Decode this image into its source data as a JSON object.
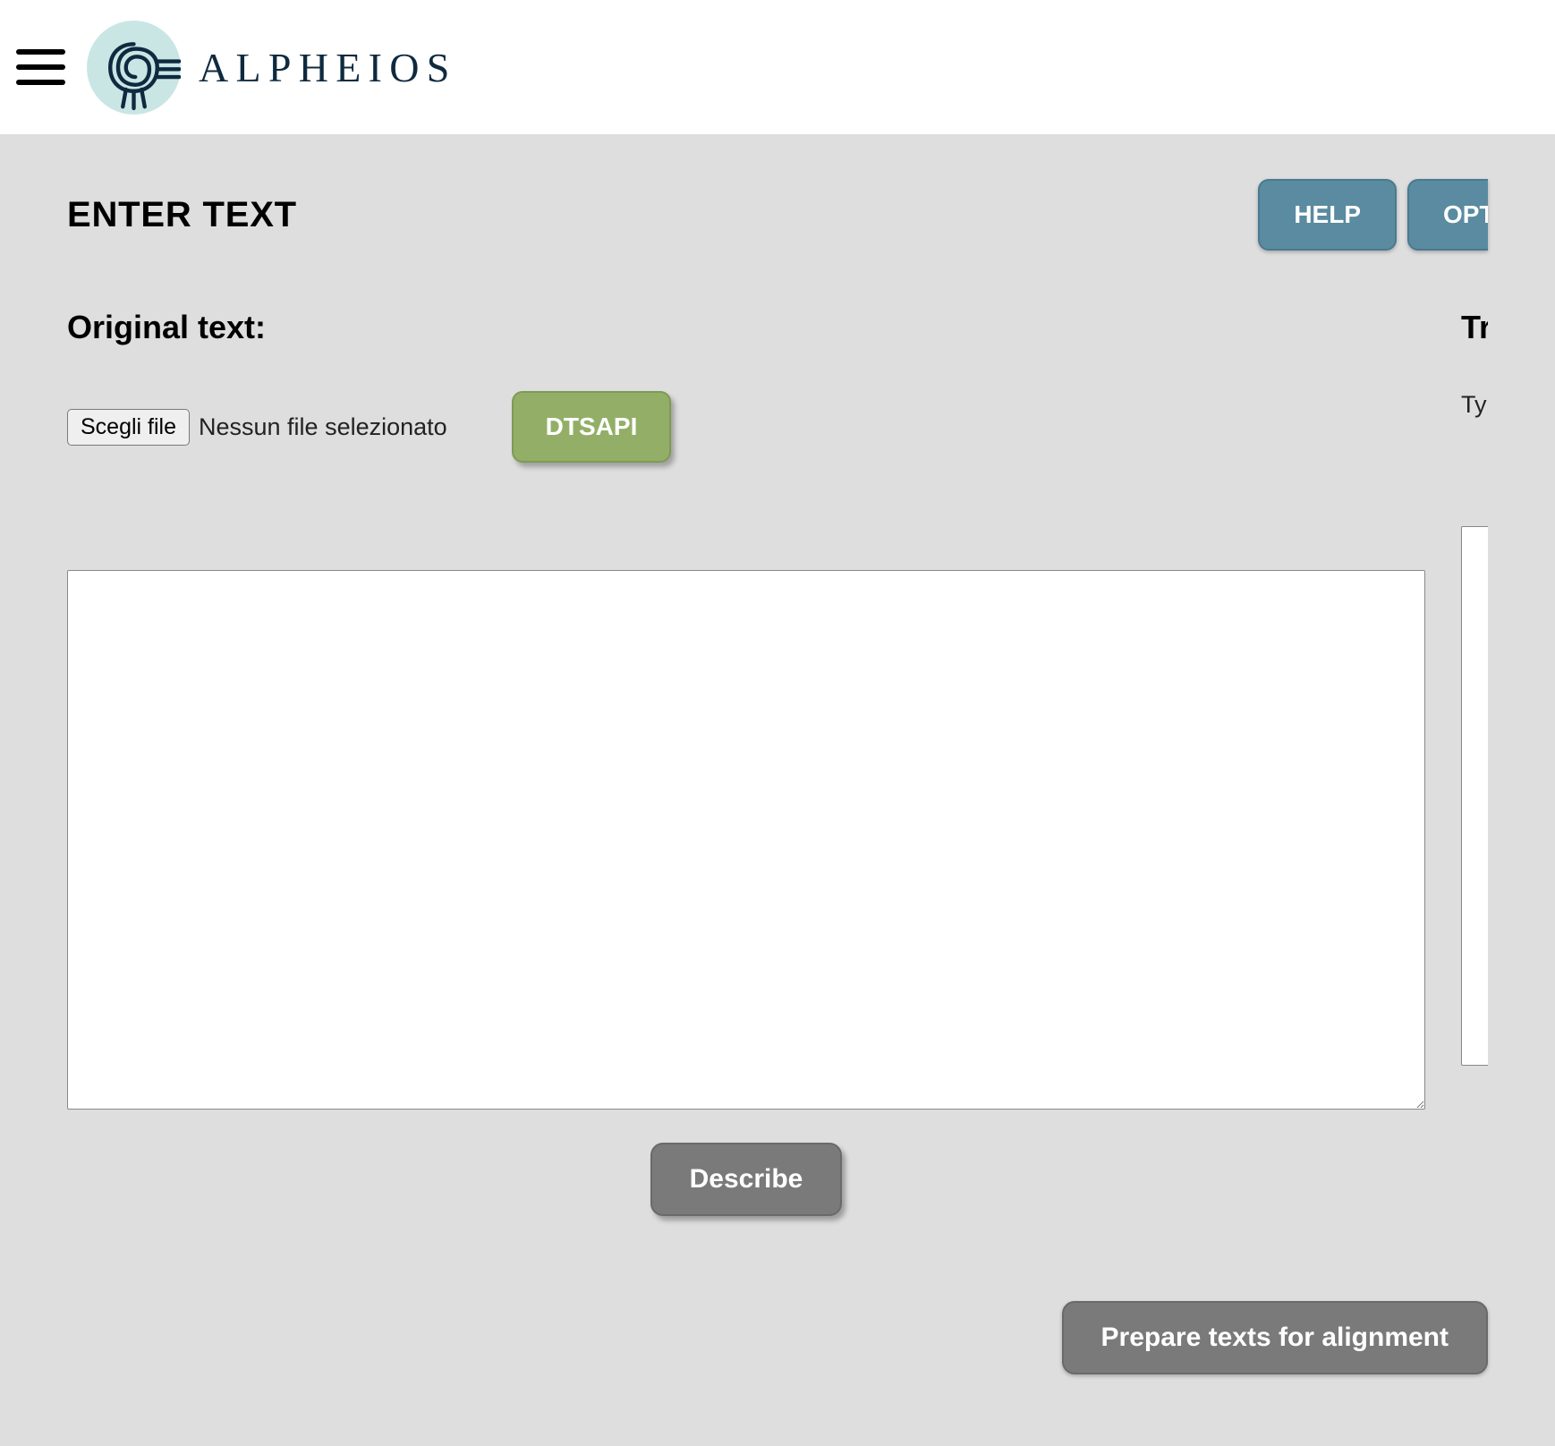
{
  "header": {
    "brand_text": "ALPHEIOS"
  },
  "page": {
    "title": "ENTER TEXT"
  },
  "top_buttons": {
    "help": "HELP",
    "options_partial": "OPT"
  },
  "left_panel": {
    "label": "Original text:",
    "file_choose": "Scegli file",
    "file_status": "Nessun file selezionato",
    "dtsapi": "DTSAPI",
    "textarea_value": ""
  },
  "right_panel": {
    "label_partial": "Tr",
    "type_partial": "Ty"
  },
  "actions": {
    "describe": "Describe",
    "prepare": "Prepare texts for alignment"
  }
}
